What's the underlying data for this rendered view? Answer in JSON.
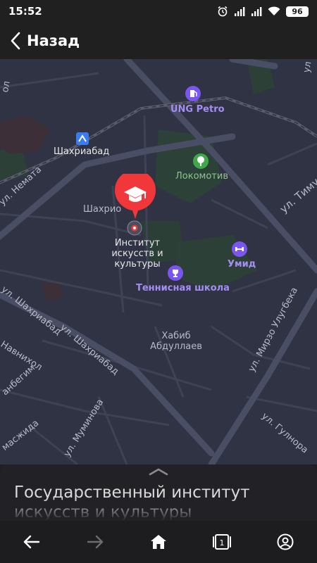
{
  "status_bar": {
    "time": "15:52",
    "battery": "96",
    "icons": [
      "alarm-icon",
      "signal-icon",
      "signal-icon",
      "wifi-icon",
      "battery-icon"
    ]
  },
  "header": {
    "back_label": "Назад"
  },
  "map": {
    "labels": {
      "ung_petro": "UNG Petro",
      "shakhriabad_station": "Шахриабад",
      "lokomotiv": "Локомотив",
      "ul_nemata": "ул. Немата",
      "ul_timur": "ул. Тиму",
      "shakhrio": "Шахрио",
      "institute": "Институт\nискусств и\nкультуры",
      "umid": "Умид",
      "tennis": "Теннисная школа",
      "habib": "Хабиб\nАбдуллаев",
      "ul_mirzo": "ул. Мирзо Улугбека",
      "ul_shakhriabad_1": "ул. Шахриабад",
      "ul_shakhriabad_2": "ул. Шахриабад",
      "navnikhol": "Навнихол",
      "anbegim": "анбегим",
      "ul_muminova": "ул. Муминова",
      "ul_gulnora": "ул. Гулнора",
      "mazhida": "масжида",
      "edge_ol": "ол",
      "edge_ul": "ул"
    },
    "icons": [
      "fuel-icon",
      "metro-icon",
      "park-icon",
      "gym-icon",
      "trophy-icon",
      "graduation-cap-icon",
      "location-marker-icon"
    ],
    "colors": {
      "background": "#303343",
      "poi": "#a58df5",
      "pin": "#f2373a"
    }
  },
  "sheet": {
    "title": "Государственный институт\nискусств и культуры"
  },
  "bottom_nav": {
    "icons": [
      "back-arrow-icon",
      "forward-arrow-icon",
      "home-icon",
      "tabs-icon",
      "profile-icon"
    ],
    "tab_count": "1"
  }
}
